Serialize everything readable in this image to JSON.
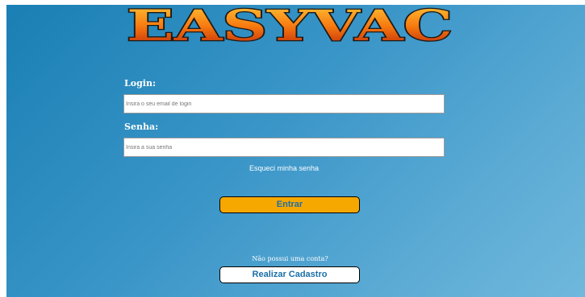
{
  "logo": {
    "text": "EASYVAC"
  },
  "login": {
    "label": "Login:",
    "placeholder": "Insira o seu email de login",
    "value": ""
  },
  "password": {
    "label": "Senha:",
    "placeholder": "Insira a sua senha",
    "value": ""
  },
  "forgot_password": "Esqueci minha senha",
  "submit_label": "Entrar",
  "signup": {
    "prompt": "Não possui uma conta?",
    "button_label": "Realizar Cadastro"
  },
  "colors": {
    "background_start": "#1a7fb4",
    "background_end": "#70b8dc",
    "logo_fill_top": "#ffb020",
    "logo_fill_bottom": "#c02810",
    "primary_button": "#f7a800",
    "button_text": "#1a6fa8"
  }
}
